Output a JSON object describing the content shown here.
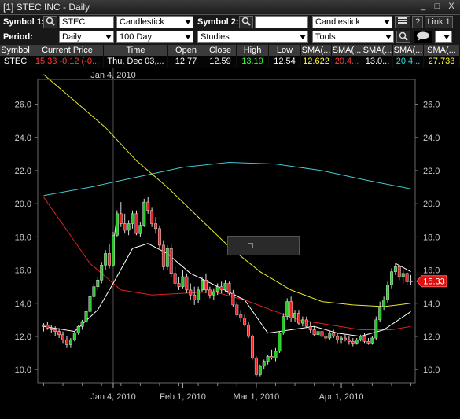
{
  "window": {
    "title": "[1] STEC INC - Daily",
    "min": "_",
    "max": "□",
    "close": "X"
  },
  "toolbar1": {
    "symbol1_label": "Symbol 1:",
    "symbol1_value": "STEC",
    "chart_type": "Candlestick",
    "symbol2_label": "Symbol 2:",
    "symbol2_value": "",
    "chart_type2": "Candlestick",
    "help": "?",
    "link": "Link 1"
  },
  "toolbar2": {
    "period_label": "Period:",
    "period": "Daily",
    "range": "100 Day",
    "studies": "Studies",
    "tools": "Tools"
  },
  "quote_table": {
    "headers": [
      "Symbol",
      "Current Price",
      "Time",
      "Open",
      "Close",
      "High",
      "Low",
      "SMA(...",
      "SMA(...",
      "SMA(...",
      "SMA(...",
      "SMA(..."
    ],
    "row": [
      "STEC",
      "15.33 -0.12 (-0...",
      "Thu, Dec 03,...",
      "12.77",
      "12.59",
      "13.19",
      "12.54",
      "12.622",
      "20.4...",
      "13.0...",
      "20.4...",
      "27.733"
    ],
    "colors": [
      "#ffffff",
      "#ff3b3b",
      "#ffffff",
      "#ffffff",
      "#ffffff",
      "#33ff33",
      "#ffffff",
      "#ffff33",
      "#ff3b3b",
      "#ffffff",
      "#33dddd",
      "#ffff33"
    ]
  },
  "chart_data": {
    "type": "candlestick",
    "symbol": "STEC",
    "period": "Daily",
    "ylim": [
      9.2,
      27.5
    ],
    "yticks": [
      "10.0",
      "12.0",
      "14.0",
      "16.0",
      "18.0",
      "20.0",
      "22.0",
      "24.0",
      "26.0"
    ],
    "xticks": [
      "Jan 4, 2010",
      "Feb 1, 2010",
      "Mar 1, 2010",
      "Apr 1, 2010"
    ],
    "crosshair_label": "Jan 4, 2010",
    "last_price_label": "15.33",
    "colors": {
      "up": "#22cc22",
      "down": "#ee2222",
      "sma_yellow": "#e8e830",
      "sma_white": "#ffffff",
      "sma_red": "#e02020",
      "sma_cyan": "#40c8d0"
    },
    "candles": [
      [
        12.6,
        12.8,
        12.3,
        12.7
      ],
      [
        12.7,
        12.9,
        12.4,
        12.5
      ],
      [
        12.5,
        12.7,
        12.2,
        12.4
      ],
      [
        12.4,
        12.6,
        12.0,
        12.3
      ],
      [
        12.3,
        12.5,
        11.9,
        12.1
      ],
      [
        12.1,
        12.3,
        11.6,
        11.8
      ],
      [
        11.8,
        12.0,
        11.3,
        11.5
      ],
      [
        11.5,
        11.9,
        11.3,
        11.8
      ],
      [
        11.8,
        12.3,
        11.7,
        12.2
      ],
      [
        12.2,
        12.7,
        12.1,
        12.6
      ],
      [
        12.6,
        13.0,
        12.4,
        12.9
      ],
      [
        12.9,
        13.7,
        12.8,
        13.5
      ],
      [
        13.5,
        14.6,
        13.4,
        14.4
      ],
      [
        14.4,
        15.2,
        14.2,
        15.0
      ],
      [
        15.0,
        15.6,
        14.8,
        15.4
      ],
      [
        15.4,
        16.5,
        15.2,
        16.3
      ],
      [
        16.3,
        17.2,
        16.0,
        17.0
      ],
      [
        17.0,
        17.6,
        16.1,
        16.3
      ],
      [
        16.3,
        18.3,
        16.2,
        18.1
      ],
      [
        18.1,
        19.6,
        18.0,
        19.4
      ],
      [
        19.4,
        20.1,
        18.6,
        18.8
      ],
      [
        18.8,
        19.4,
        18.2,
        18.4
      ],
      [
        18.4,
        19.0,
        18.1,
        18.8
      ],
      [
        18.8,
        19.6,
        18.5,
        19.4
      ],
      [
        19.4,
        19.6,
        18.1,
        18.2
      ],
      [
        18.2,
        18.9,
        18.0,
        18.7
      ],
      [
        18.7,
        20.3,
        18.6,
        20.1
      ],
      [
        20.1,
        20.4,
        19.4,
        19.6
      ],
      [
        19.6,
        19.8,
        18.6,
        18.8
      ],
      [
        18.8,
        19.2,
        18.2,
        18.5
      ],
      [
        18.5,
        18.7,
        17.3,
        17.5
      ],
      [
        17.5,
        17.8,
        16.0,
        16.2
      ],
      [
        16.2,
        17.5,
        16.0,
        17.3
      ],
      [
        17.3,
        17.6,
        15.6,
        15.8
      ],
      [
        15.8,
        16.2,
        15.0,
        15.2
      ],
      [
        15.2,
        15.6,
        14.8,
        15.0
      ],
      [
        15.0,
        16.0,
        14.9,
        15.6
      ],
      [
        15.6,
        15.8,
        14.6,
        14.8
      ],
      [
        14.8,
        15.2,
        14.2,
        14.5
      ],
      [
        14.5,
        15.0,
        13.9,
        14.2
      ],
      [
        14.2,
        15.0,
        14.0,
        14.8
      ],
      [
        14.8,
        15.6,
        14.7,
        15.4
      ],
      [
        15.4,
        15.8,
        14.6,
        14.8
      ],
      [
        14.8,
        15.0,
        14.3,
        14.5
      ],
      [
        14.5,
        14.9,
        14.2,
        14.7
      ],
      [
        14.7,
        15.2,
        14.5,
        15.0
      ],
      [
        15.0,
        15.3,
        14.6,
        14.8
      ],
      [
        14.8,
        15.4,
        14.7,
        15.2
      ],
      [
        15.2,
        15.3,
        14.5,
        14.6
      ],
      [
        14.6,
        14.8,
        13.8,
        13.9
      ],
      [
        13.9,
        14.1,
        13.2,
        13.3
      ],
      [
        13.3,
        13.6,
        12.9,
        13.1
      ],
      [
        13.1,
        13.3,
        12.6,
        12.7
      ],
      [
        12.7,
        12.9,
        11.9,
        12.0
      ],
      [
        12.0,
        12.1,
        10.6,
        10.7
      ],
      [
        10.7,
        10.8,
        9.6,
        9.7
      ],
      [
        9.7,
        10.3,
        9.6,
        10.2
      ],
      [
        10.2,
        10.6,
        10.0,
        10.5
      ],
      [
        10.5,
        10.9,
        10.3,
        10.8
      ],
      [
        10.8,
        11.2,
        10.6,
        10.7
      ],
      [
        10.7,
        11.3,
        10.5,
        11.1
      ],
      [
        11.1,
        12.3,
        11.0,
        12.2
      ],
      [
        12.2,
        13.4,
        12.1,
        13.2
      ],
      [
        13.2,
        14.3,
        13.0,
        14.1
      ],
      [
        14.1,
        14.4,
        12.9,
        13.1
      ],
      [
        13.1,
        13.6,
        12.9,
        13.4
      ],
      [
        13.4,
        13.6,
        12.7,
        12.8
      ],
      [
        12.8,
        13.2,
        12.6,
        13.0
      ],
      [
        13.0,
        13.2,
        12.5,
        12.6
      ],
      [
        12.6,
        12.9,
        12.2,
        12.4
      ],
      [
        12.4,
        12.6,
        12.0,
        12.1
      ],
      [
        12.1,
        12.4,
        11.9,
        12.3
      ],
      [
        12.3,
        12.5,
        11.9,
        12.0
      ],
      [
        12.0,
        12.2,
        11.7,
        11.9
      ],
      [
        11.9,
        12.3,
        11.8,
        12.2
      ],
      [
        12.2,
        12.4,
        11.9,
        12.0
      ],
      [
        12.0,
        12.2,
        11.6,
        11.8
      ],
      [
        11.8,
        12.0,
        11.6,
        11.9
      ],
      [
        11.9,
        12.1,
        11.7,
        11.8
      ],
      [
        11.8,
        12.0,
        11.5,
        11.7
      ],
      [
        11.7,
        11.9,
        11.4,
        11.6
      ],
      [
        11.6,
        11.9,
        11.5,
        11.8
      ],
      [
        11.8,
        12.1,
        11.7,
        12.0
      ],
      [
        12.0,
        12.2,
        11.6,
        11.7
      ],
      [
        11.7,
        11.9,
        11.5,
        11.6
      ],
      [
        11.6,
        12.0,
        11.5,
        11.9
      ],
      [
        11.9,
        13.2,
        11.8,
        13.0
      ],
      [
        13.0,
        14.1,
        12.9,
        13.8
      ],
      [
        13.8,
        14.4,
        13.6,
        14.2
      ],
      [
        14.2,
        15.3,
        14.0,
        15.1
      ],
      [
        15.1,
        16.1,
        14.9,
        15.9
      ],
      [
        15.9,
        16.4,
        15.7,
        16.2
      ],
      [
        16.2,
        16.3,
        15.4,
        15.6
      ],
      [
        15.6,
        16.0,
        15.2,
        15.8
      ],
      [
        15.8,
        15.9,
        15.1,
        15.3
      ],
      [
        15.3,
        15.7,
        15.1,
        15.33
      ]
    ],
    "sma_yellow": [
      [
        0,
        27.8
      ],
      [
        8,
        26.2
      ],
      [
        16,
        24.6
      ],
      [
        24,
        22.6
      ],
      [
        32,
        21.0
      ],
      [
        40,
        19.2
      ],
      [
        48,
        17.4
      ],
      [
        56,
        15.9
      ],
      [
        64,
        14.8
      ],
      [
        72,
        14.1
      ],
      [
        80,
        13.9
      ],
      [
        88,
        13.8
      ],
      [
        95,
        14.0
      ]
    ],
    "sma_white": [
      [
        0,
        12.6
      ],
      [
        8,
        12.3
      ],
      [
        14,
        13.6
      ],
      [
        18,
        15.2
      ],
      [
        23,
        17.3
      ],
      [
        27,
        17.6
      ],
      [
        32,
        17.0
      ],
      [
        38,
        15.8
      ],
      [
        46,
        14.9
      ],
      [
        52,
        14.2
      ],
      [
        58,
        12.2
      ],
      [
        64,
        12.4
      ],
      [
        70,
        12.6
      ],
      [
        76,
        12.2
      ],
      [
        82,
        12.0
      ],
      [
        88,
        12.4
      ],
      [
        95,
        13.5
      ]
    ],
    "sma_red": [
      [
        0,
        20.4
      ],
      [
        6,
        18.4
      ],
      [
        12,
        16.4
      ],
      [
        20,
        14.8
      ],
      [
        28,
        14.5
      ],
      [
        36,
        14.6
      ],
      [
        44,
        14.7
      ],
      [
        52,
        14.2
      ],
      [
        60,
        13.5
      ],
      [
        66,
        13.0
      ],
      [
        74,
        12.7
      ],
      [
        82,
        12.4
      ],
      [
        90,
        12.4
      ],
      [
        95,
        12.6
      ]
    ],
    "sma_cyan": [
      [
        0,
        20.5
      ],
      [
        12,
        21.0
      ],
      [
        24,
        21.6
      ],
      [
        36,
        22.2
      ],
      [
        48,
        22.5
      ],
      [
        60,
        22.4
      ],
      [
        72,
        22.0
      ],
      [
        84,
        21.4
      ],
      [
        95,
        20.9
      ]
    ],
    "trend_segments": [
      [
        [
          18,
          17.5
        ],
        [
          19,
          19.3
        ]
      ],
      [
        [
          91,
          16.4
        ],
        [
          95,
          15.9
        ]
      ]
    ]
  },
  "popup": {}
}
